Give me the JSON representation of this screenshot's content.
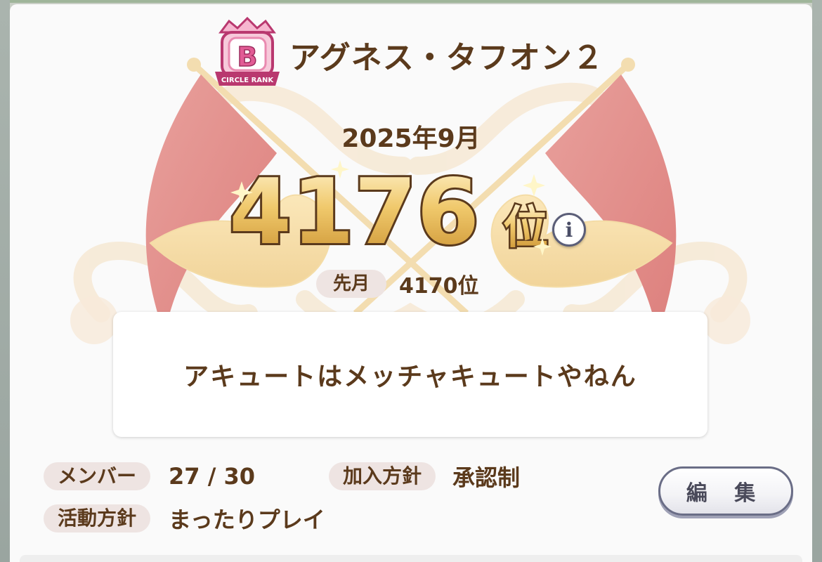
{
  "circle": {
    "rank_letter": "B",
    "rank_caption": "CIRCLE RANK",
    "name": "アグネス・タフオン２"
  },
  "ranking": {
    "month": "2025年9月",
    "rank_number": "4176",
    "rank_suffix": "位",
    "prev_label": "先月",
    "prev_value": "4170位",
    "info_icon": "info-icon"
  },
  "motto": "アキュートはメッチャキュートやねん",
  "details": {
    "member_label": "メンバー",
    "member_value": "27 / 30",
    "join_label": "加入方針",
    "join_value": "承認制",
    "activity_label": "活動方針",
    "activity_value": "まったりプレイ"
  },
  "edit_button": "編 集",
  "colors": {
    "text_brown": "#5b3a1c",
    "pill_bg": "#eee4e2",
    "flag_red": "#e58d8b",
    "gold": "#e8c66a"
  }
}
